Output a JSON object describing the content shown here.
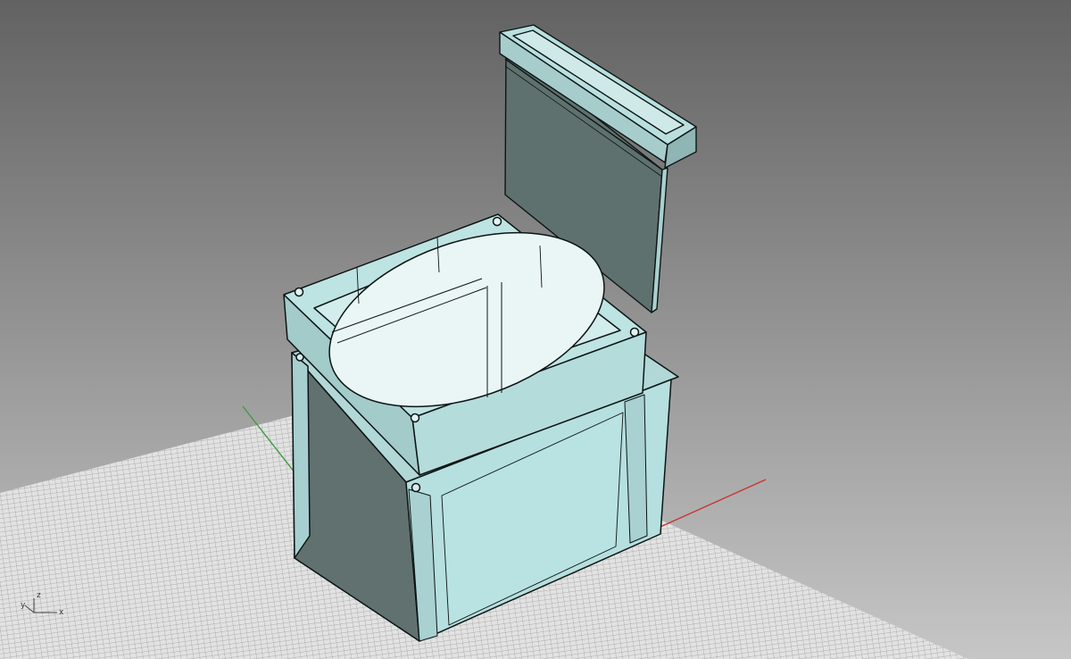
{
  "viewport": {
    "background_top": "#5f5f5f",
    "background_bottom": "#c4c4c4",
    "grid_color": "#9a9a9a",
    "grid_fill": "#e4e4e4",
    "x_axis_color": "#c0302a",
    "y_axis_color": "#3a9a3a",
    "model_fill": "#b6dcdc",
    "model_fill_dark": "#5f7270",
    "model_edge": "#0d1414"
  },
  "axis_widget": {
    "x_label": "x",
    "y_label": "y",
    "z_label": "z"
  }
}
